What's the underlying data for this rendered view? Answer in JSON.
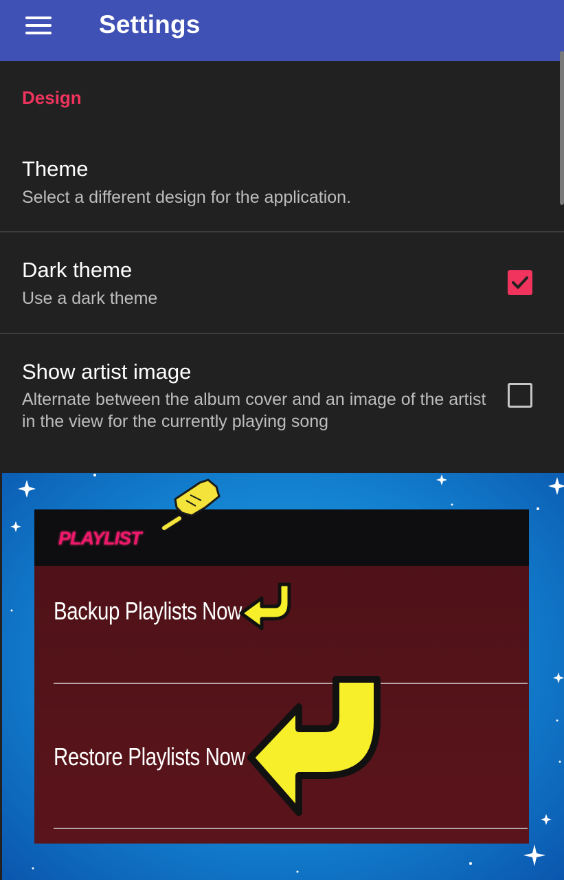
{
  "appbar": {
    "title": "Settings",
    "background": "#3f51b5",
    "menu_icon": "hamburger-menu-icon"
  },
  "section": {
    "header": "Design",
    "header_color": "#f0345e"
  },
  "preferences": [
    {
      "title": "Theme",
      "summary": "Select a different design for the application.",
      "control": "none"
    },
    {
      "title": "Dark theme",
      "summary": "Use a dark theme",
      "control": "checkbox",
      "checked": true
    },
    {
      "title": "Show artist image",
      "summary": "Alternate between the album cover and an image of the artist in the view for the currently playing song",
      "control": "checkbox",
      "checked": false
    }
  ],
  "colors": {
    "background": "#212121",
    "accent": "#f0345e",
    "title_text": "#ffffff",
    "summary_text": "#bdbdbd"
  },
  "ad_banner": {
    "header_label": "PLAYLIST",
    "items": [
      "Backup Playlists Now",
      "Restore Playlists Now"
    ],
    "icons": [
      "pointing-hand-icon",
      "curved-arrow-icon",
      "large-curved-arrow-icon"
    ]
  }
}
